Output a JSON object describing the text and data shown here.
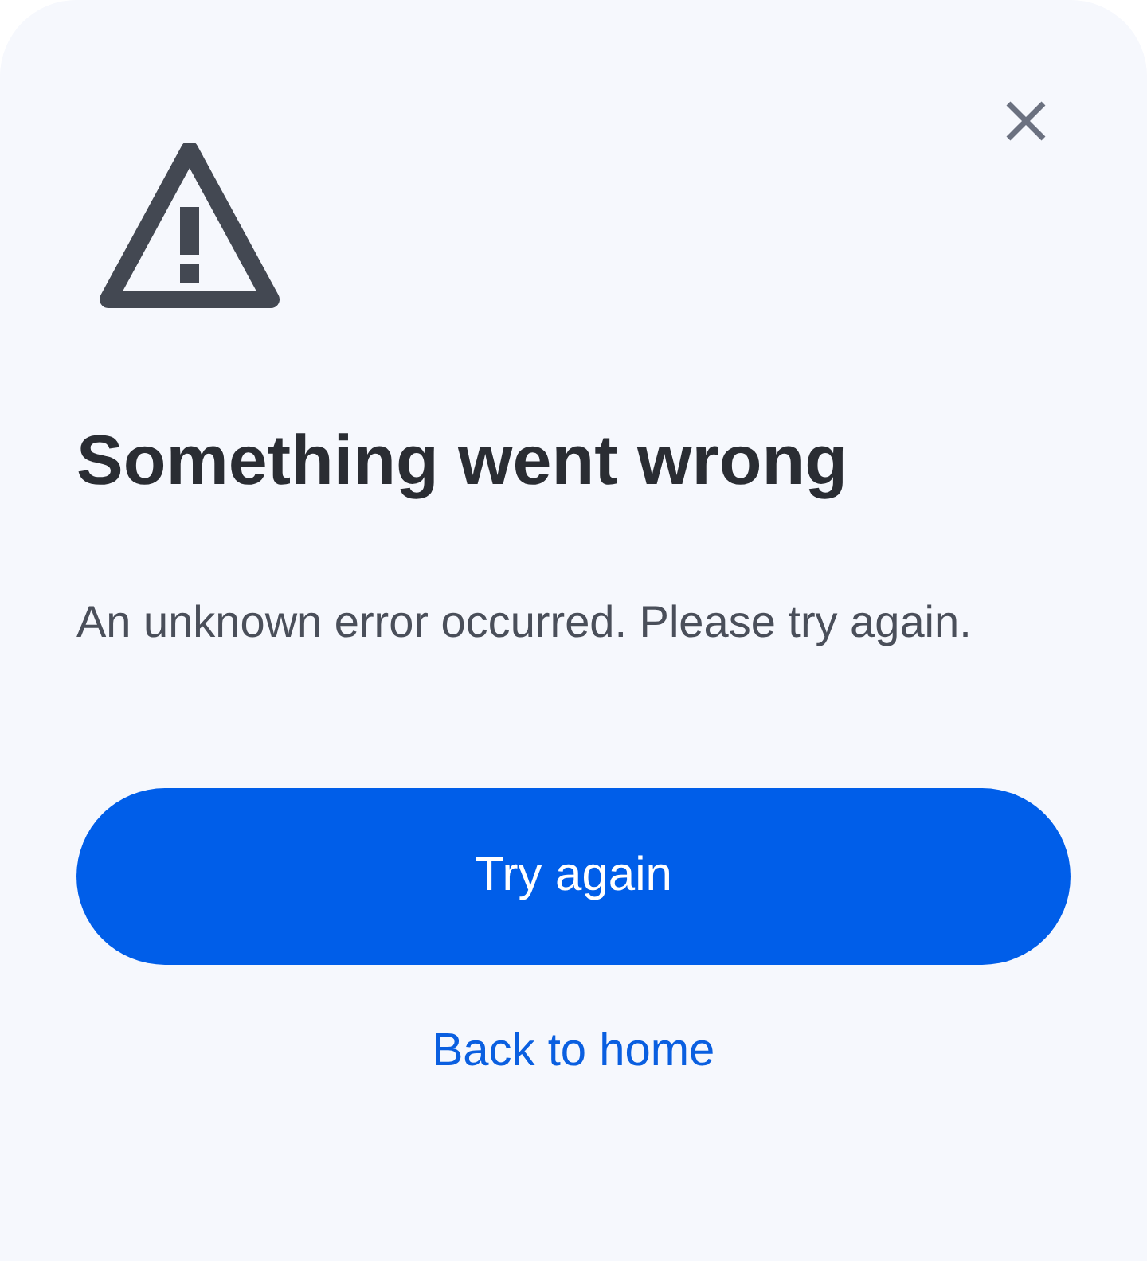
{
  "dialog": {
    "title": "Something went wrong",
    "message": "An unknown error occurred. Please try again.",
    "primary_button": "Try again",
    "link": "Back to home"
  }
}
